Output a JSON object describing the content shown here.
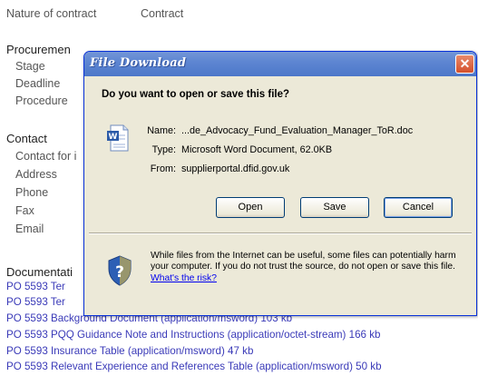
{
  "page": {
    "nature_label": "Nature of contract",
    "nature_value": "Contract",
    "procurement": {
      "heading": "Procuremen",
      "fields": [
        "Stage",
        "Deadline",
        "Procedure"
      ]
    },
    "contact": {
      "heading": "Contact",
      "fields": [
        "Contact for i",
        "Address",
        "Phone",
        "Fax",
        "Email"
      ]
    },
    "documentation": {
      "heading": "Documentati",
      "links": [
        "PO 5593 Ter",
        "PO 5593 Ter",
        "PO 5593 Background Document (application/msword) 103 kb",
        "PO 5593 PQQ Guidance Note and Instructions (application/octet-stream) 166 kb",
        "PO 5593 Insurance Table (application/msword) 47 kb",
        "PO 5593 Relevant Experience and References Table (application/msword) 50 kb"
      ]
    }
  },
  "dialog": {
    "title": "File Download",
    "close_glyph": "✕",
    "question": "Do you want to open or save this file?",
    "file_icon": "word-document-icon",
    "name_label": "Name:",
    "name_value": "...de_Advocacy_Fund_Evaluation_Manager_ToR.doc",
    "type_label": "Type:",
    "type_value": "Microsoft Word Document, 62.0KB",
    "from_label": "From:",
    "from_value": "supplierportal.dfid.gov.uk",
    "buttons": {
      "open": "Open",
      "save": "Save",
      "cancel": "Cancel"
    },
    "warning_icon": "shield-question-icon",
    "warning_text": "While files from the Internet can be useful, some files can potentially harm your computer. If you do not trust the source, do not open or save this file.",
    "risk_link": "What's the risk?"
  },
  "colors": {
    "link": "#3a3ab8",
    "title_bar": "#5e86d2",
    "dialog_bg": "#ece9d8",
    "close_button": "#d4502c"
  }
}
